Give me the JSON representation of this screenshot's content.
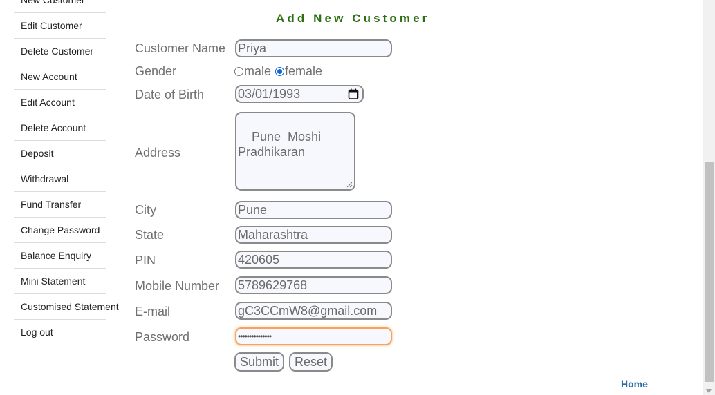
{
  "sidebar": {
    "items": [
      {
        "label": "New Customer"
      },
      {
        "label": "Edit Customer"
      },
      {
        "label": "Delete Customer"
      },
      {
        "label": "New Account"
      },
      {
        "label": "Edit Account"
      },
      {
        "label": "Delete Account"
      },
      {
        "label": "Deposit"
      },
      {
        "label": "Withdrawal"
      },
      {
        "label": "Fund Transfer"
      },
      {
        "label": "Change Password"
      },
      {
        "label": "Balance Enquiry"
      },
      {
        "label": "Mini Statement"
      },
      {
        "label": "Customised Statement"
      },
      {
        "label": "Log out"
      }
    ]
  },
  "form": {
    "title": "Add New Customer",
    "customer_name": {
      "label": "Customer Name",
      "value": "Priya"
    },
    "gender": {
      "label": "Gender",
      "options": [
        {
          "label": "male",
          "checked": false
        },
        {
          "label": "female",
          "checked": true
        }
      ]
    },
    "dob": {
      "label": "Date of Birth",
      "value": "03/01/1993",
      "icon": "calendar-icon"
    },
    "address": {
      "label": "Address",
      "value": "Pune  Moshi\nPradhikaran"
    },
    "city": {
      "label": "City",
      "value": "Pune"
    },
    "state": {
      "label": "State",
      "value": "Maharashtra"
    },
    "pin": {
      "label": "PIN",
      "value": "420605"
    },
    "mobile": {
      "label": "Mobile Number",
      "value": "5789629768"
    },
    "email": {
      "label": "E-mail",
      "value": "gC3CCmW8@gmail.com"
    },
    "password": {
      "label": "Password",
      "masked_value": "•••••••••••••••"
    },
    "submit_label": "Submit",
    "reset_label": "Reset"
  },
  "footer": {
    "home_link": "Home"
  },
  "colors": {
    "title": "#2c6e12",
    "label": "#707070",
    "focus_border": "#f5a45a",
    "link": "#2a6ba6",
    "radio_checked": "#0b69d4"
  }
}
